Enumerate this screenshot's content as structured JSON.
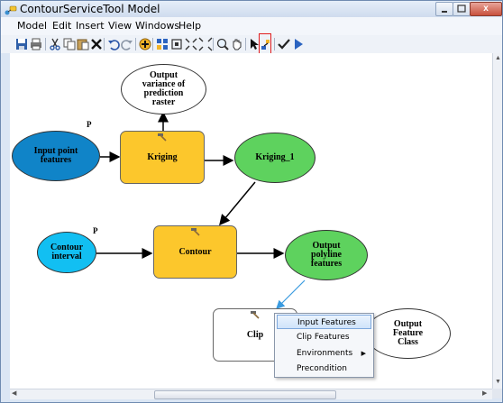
{
  "window": {
    "title": "ContourServiceTool Model",
    "controls": {
      "close": "x"
    }
  },
  "menu": [
    "Model",
    "Edit",
    "Insert",
    "View",
    "Windows",
    "Help"
  ],
  "toolbar": {
    "icons": [
      "save-icon",
      "print-icon",
      "cut-icon",
      "copy-icon",
      "paste-icon",
      "delete-icon",
      "undo-icon",
      "redo-icon",
      "add-data-icon",
      "auto-layout-icon",
      "full-extent-icon",
      "zoom-in-icon",
      "zoom-out-icon",
      "zoom-tool-icon",
      "pan-icon",
      "select-icon",
      "connect-icon",
      "validate-icon",
      "run-icon"
    ]
  },
  "model": {
    "input_point_features": "Input point\nfeatures",
    "kriging": "Kriging",
    "output_variance": "Output\nvariance of\nprediction\nraster",
    "kriging_1": "Kriging_1",
    "contour_interval": "Contour\ninterval",
    "contour": "Contour",
    "output_polyline": "Output\npolyline\nfeatures",
    "clip": "Clip",
    "output_feature_class": "Output\nFeature\nClass",
    "param_marker": "P"
  },
  "context_menu": {
    "items": [
      "Input Features",
      "Clip Features",
      "Environments",
      "Precondition"
    ],
    "highlighted": "Input Features"
  },
  "colors": {
    "input_dark": "#1084c8",
    "input_light": "#12bff2",
    "derived": "#5ed25e",
    "tool": "#fcc72c",
    "selection_box": "#e01c1c"
  }
}
